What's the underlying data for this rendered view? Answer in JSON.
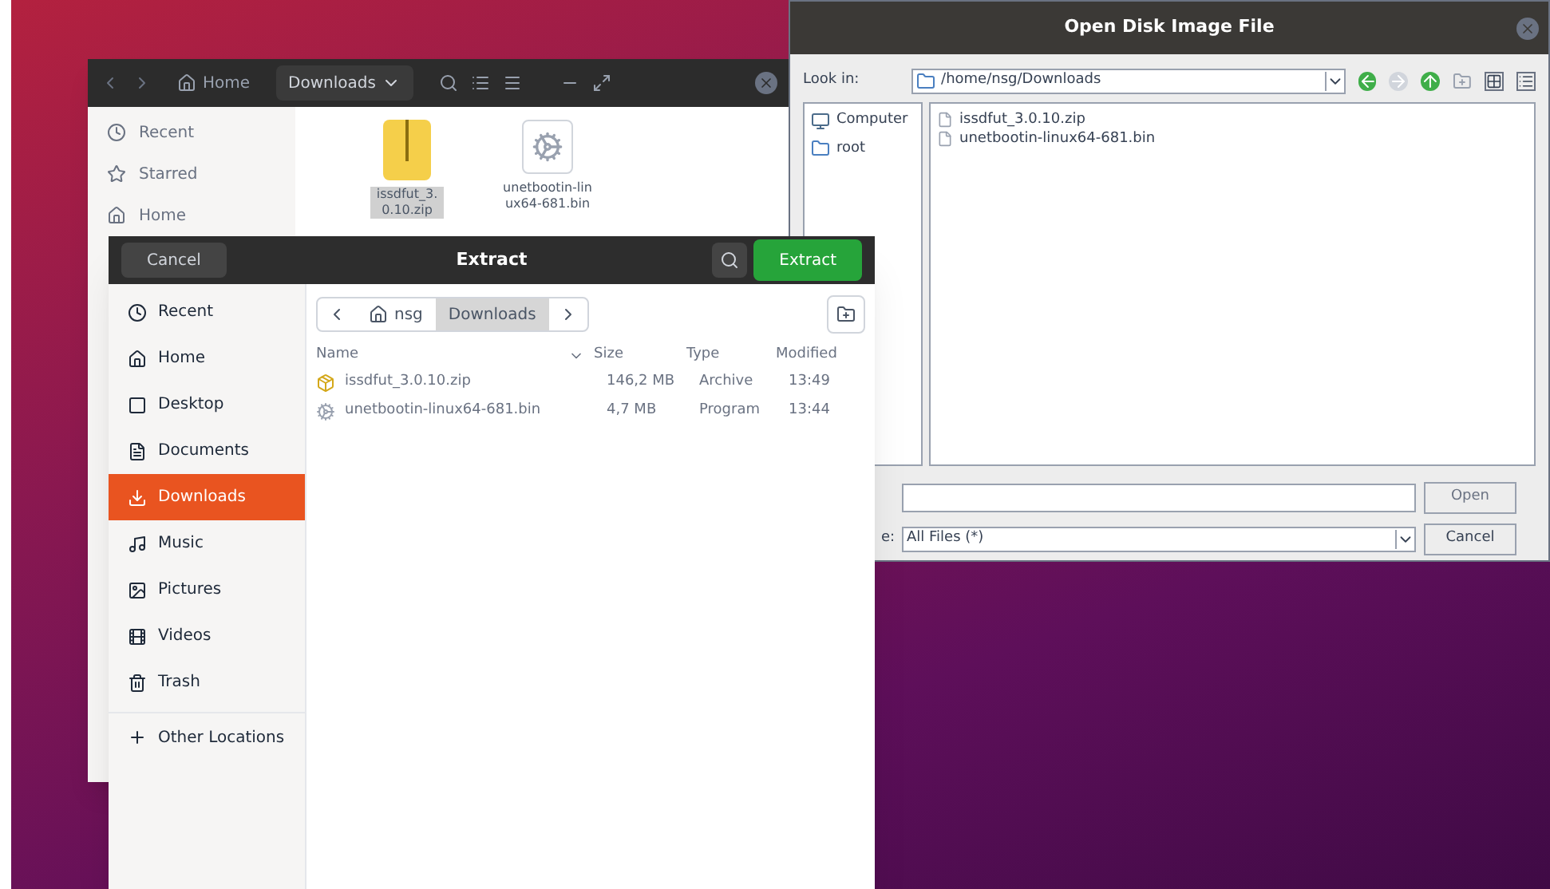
{
  "file_manager": {
    "nav": [
      {
        "label": "Home",
        "selected": false
      },
      {
        "label": "Downloads",
        "selected": true
      }
    ],
    "sidebar": [
      {
        "label": "Recent"
      },
      {
        "label": "Starred"
      },
      {
        "label": "Home"
      }
    ],
    "files": [
      {
        "name": "issdfut_3.0.10.zip",
        "kind": "archive",
        "selected": true
      },
      {
        "name": "unetbootin-linux64-681.bin",
        "kind": "program",
        "selected": false
      }
    ]
  },
  "open_dialog": {
    "title": "Open Disk Image File",
    "look_in_label": "Look in:",
    "path": "/home/nsg/Downloads",
    "places": [
      {
        "label": "Computer",
        "kind": "computer"
      },
      {
        "label": "root",
        "kind": "folder"
      }
    ],
    "files": [
      "issdfut_3.0.10.zip",
      "unetbootin-linux64-681.bin"
    ],
    "open_button": {
      "label": "Open",
      "disabled": true
    },
    "file_type_label": "e:",
    "file_type": "All Files (*)",
    "cancel_button": "Cancel"
  },
  "extract_dialog": {
    "title": "Extract",
    "cancel_button": "Cancel",
    "extract_button": "Extract",
    "path": [
      {
        "label": "nsg",
        "selected": false
      },
      {
        "label": "Downloads",
        "selected": true
      }
    ],
    "sidebar": [
      {
        "label": "Recent",
        "selected": false
      },
      {
        "label": "Home",
        "selected": false
      },
      {
        "label": "Desktop",
        "selected": false
      },
      {
        "label": "Documents",
        "selected": false
      },
      {
        "label": "Downloads",
        "selected": true
      },
      {
        "label": "Music",
        "selected": false
      },
      {
        "label": "Pictures",
        "selected": false
      },
      {
        "label": "Videos",
        "selected": false
      },
      {
        "label": "Trash",
        "selected": false
      }
    ],
    "other_locations": "Other Locations",
    "columns": [
      "Name",
      "Size",
      "Type",
      "Modified"
    ],
    "rows": [
      {
        "name": "issdfut_3.0.10.zip",
        "kind": "archive",
        "size": "146,2 MB",
        "type": "Archive",
        "modified": "13:49",
        "disabled": true
      },
      {
        "name": "unetbootin-linux64-681.bin",
        "kind": "program",
        "size": "4,7 MB",
        "type": "Program",
        "modified": "13:44",
        "disabled": true
      }
    ]
  }
}
